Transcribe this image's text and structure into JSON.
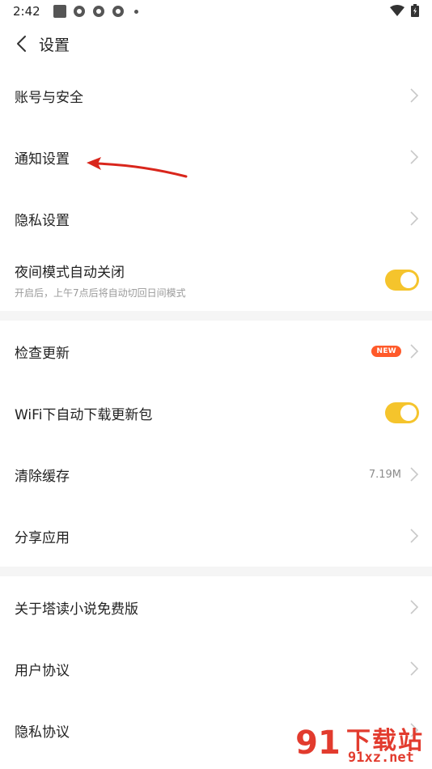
{
  "status_bar": {
    "time": "2:42"
  },
  "header": {
    "title": "设置"
  },
  "section1": [
    {
      "label": "账号与安全"
    },
    {
      "label": "通知设置"
    },
    {
      "label": "隐私设置"
    },
    {
      "label": "夜间模式自动关闭",
      "sub": "开启后，上午7点后将自动切回日间模式",
      "toggle_on": true
    }
  ],
  "section2": [
    {
      "label": "检查更新",
      "badge": "NEW"
    },
    {
      "label": "WiFi下自动下载更新包",
      "toggle_on": true
    },
    {
      "label": "清除缓存",
      "value": "7.19M"
    },
    {
      "label": "分享应用"
    }
  ],
  "section3": [
    {
      "label": "关于塔读小说免费版"
    },
    {
      "label": "用户协议"
    },
    {
      "label": "隐私协议"
    }
  ],
  "colors": {
    "toggle_on": "#f5c42c",
    "badge": "#ff5a2a",
    "annotation_arrow": "#d9261c",
    "watermark": "#e23b2e"
  },
  "watermark": {
    "top": "下载站",
    "bottom": "91xz.net"
  }
}
